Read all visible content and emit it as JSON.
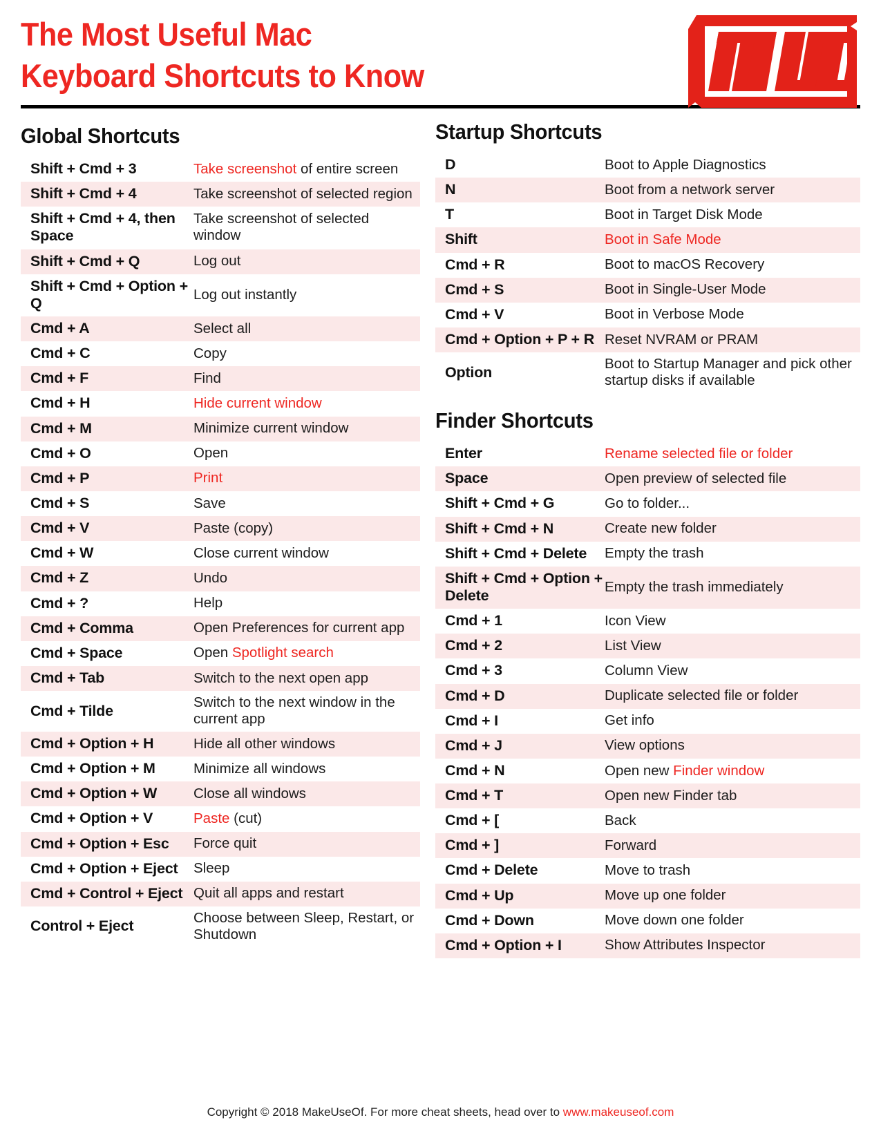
{
  "header": {
    "title": "The Most Useful Mac\nKeyboard Shortcuts to Know",
    "logo_text": "MUO",
    "accent_color": "#ee2722",
    "shade_color": "#fbe8e8"
  },
  "sections": [
    {
      "id": "global",
      "heading": "Global Shortcuts",
      "rows": [
        {
          "keys": "Shift + Cmd + 3",
          "desc_parts": [
            {
              "t": "Take screenshot",
              "hl": true
            },
            {
              "t": " of entire screen",
              "hl": false
            }
          ]
        },
        {
          "keys": "Shift + Cmd + 4",
          "desc_parts": [
            {
              "t": "Take screenshot of selected region",
              "hl": false
            }
          ]
        },
        {
          "keys": "Shift + Cmd + 4, then Space",
          "desc_parts": [
            {
              "t": "Take screenshot of selected window",
              "hl": false
            }
          ]
        },
        {
          "keys": "Shift + Cmd + Q",
          "desc_parts": [
            {
              "t": "Log out",
              "hl": false
            }
          ]
        },
        {
          "keys": "Shift + Cmd + Option + Q",
          "desc_parts": [
            {
              "t": "Log out instantly",
              "hl": false
            }
          ]
        },
        {
          "keys": "Cmd + A",
          "desc_parts": [
            {
              "t": "Select all",
              "hl": false
            }
          ]
        },
        {
          "keys": "Cmd + C",
          "desc_parts": [
            {
              "t": "Copy",
              "hl": false
            }
          ]
        },
        {
          "keys": "Cmd + F",
          "desc_parts": [
            {
              "t": "Find",
              "hl": false
            }
          ]
        },
        {
          "keys": "Cmd + H",
          "desc_parts": [
            {
              "t": "Hide current window",
              "hl": true
            }
          ]
        },
        {
          "keys": "Cmd + M",
          "desc_parts": [
            {
              "t": "Minimize current window",
              "hl": false
            }
          ]
        },
        {
          "keys": "Cmd + O",
          "desc_parts": [
            {
              "t": "Open",
              "hl": false
            }
          ]
        },
        {
          "keys": "Cmd + P",
          "desc_parts": [
            {
              "t": "Print",
              "hl": true
            }
          ]
        },
        {
          "keys": "Cmd + S",
          "desc_parts": [
            {
              "t": "Save",
              "hl": false
            }
          ]
        },
        {
          "keys": "Cmd + V",
          "desc_parts": [
            {
              "t": "Paste (copy)",
              "hl": false
            }
          ]
        },
        {
          "keys": "Cmd + W",
          "desc_parts": [
            {
              "t": "Close current window",
              "hl": false
            }
          ]
        },
        {
          "keys": "Cmd + Z",
          "desc_parts": [
            {
              "t": "Undo",
              "hl": false
            }
          ]
        },
        {
          "keys": "Cmd + ?",
          "desc_parts": [
            {
              "t": "Help",
              "hl": false
            }
          ]
        },
        {
          "keys": "Cmd + Comma",
          "desc_parts": [
            {
              "t": "Open Preferences for current app",
              "hl": false
            }
          ]
        },
        {
          "keys": "Cmd + Space",
          "desc_parts": [
            {
              "t": "Open ",
              "hl": false
            },
            {
              "t": "Spotlight search",
              "hl": true
            }
          ]
        },
        {
          "keys": "Cmd + Tab",
          "desc_parts": [
            {
              "t": "Switch to the next open app",
              "hl": false
            }
          ]
        },
        {
          "keys": "Cmd + Tilde",
          "desc_parts": [
            {
              "t": "Switch to the next window in the current app",
              "hl": false
            }
          ]
        },
        {
          "keys": "Cmd + Option + H",
          "desc_parts": [
            {
              "t": "Hide all other windows",
              "hl": false
            }
          ]
        },
        {
          "keys": "Cmd + Option + M",
          "desc_parts": [
            {
              "t": "Minimize all windows",
              "hl": false
            }
          ]
        },
        {
          "keys": "Cmd + Option + W",
          "desc_parts": [
            {
              "t": "Close all windows",
              "hl": false
            }
          ]
        },
        {
          "keys": "Cmd + Option + V",
          "desc_parts": [
            {
              "t": "Paste",
              "hl": true
            },
            {
              "t": " (cut)",
              "hl": false
            }
          ]
        },
        {
          "keys": "Cmd + Option + Esc",
          "desc_parts": [
            {
              "t": "Force quit",
              "hl": false
            }
          ]
        },
        {
          "keys": "Cmd + Option + Eject",
          "desc_parts": [
            {
              "t": "Sleep",
              "hl": false
            }
          ]
        },
        {
          "keys": "Cmd + Control + Eject",
          "desc_parts": [
            {
              "t": "Quit all apps and restart",
              "hl": false
            }
          ]
        },
        {
          "keys": "Control + Eject",
          "desc_parts": [
            {
              "t": "Choose between Sleep, Restart, or Shutdown",
              "hl": false
            }
          ]
        }
      ]
    },
    {
      "id": "startup",
      "heading": "Startup Shortcuts",
      "rows": [
        {
          "keys": "D",
          "desc_parts": [
            {
              "t": "Boot to Apple Diagnostics",
              "hl": false
            }
          ]
        },
        {
          "keys": "N",
          "desc_parts": [
            {
              "t": "Boot from a network server",
              "hl": false
            }
          ]
        },
        {
          "keys": "T",
          "desc_parts": [
            {
              "t": "Boot in Target Disk Mode",
              "hl": false
            }
          ]
        },
        {
          "keys": "Shift",
          "desc_parts": [
            {
              "t": "Boot in Safe Mode",
              "hl": true
            }
          ]
        },
        {
          "keys": "Cmd + R",
          "desc_parts": [
            {
              "t": "Boot to macOS Recovery",
              "hl": false
            }
          ]
        },
        {
          "keys": "Cmd + S",
          "desc_parts": [
            {
              "t": "Boot in Single-User Mode",
              "hl": false
            }
          ]
        },
        {
          "keys": "Cmd + V",
          "desc_parts": [
            {
              "t": "Boot in Verbose Mode",
              "hl": false
            }
          ]
        },
        {
          "keys": "Cmd + Option + P + R",
          "desc_parts": [
            {
              "t": "Reset NVRAM or PRAM",
              "hl": false
            }
          ]
        },
        {
          "keys": "Option",
          "desc_parts": [
            {
              "t": "Boot to Startup Manager and pick other startup disks if available",
              "hl": false
            }
          ]
        }
      ]
    },
    {
      "id": "finder",
      "heading": "Finder Shortcuts",
      "rows": [
        {
          "keys": "Enter",
          "desc_parts": [
            {
              "t": "Rename selected file or folder",
              "hl": true
            }
          ]
        },
        {
          "keys": "Space",
          "desc_parts": [
            {
              "t": "Open preview of selected file",
              "hl": false
            }
          ]
        },
        {
          "keys": "Shift + Cmd + G",
          "desc_parts": [
            {
              "t": "Go to folder...",
              "hl": false
            }
          ]
        },
        {
          "keys": "Shift + Cmd + N",
          "desc_parts": [
            {
              "t": "Create new folder",
              "hl": false
            }
          ]
        },
        {
          "keys": "Shift + Cmd + Delete",
          "desc_parts": [
            {
              "t": "Empty the trash",
              "hl": false
            }
          ]
        },
        {
          "keys": "Shift + Cmd + Option + Delete",
          "desc_parts": [
            {
              "t": "Empty the trash immediately",
              "hl": false
            }
          ]
        },
        {
          "keys": "Cmd + 1",
          "desc_parts": [
            {
              "t": "Icon View",
              "hl": false
            }
          ]
        },
        {
          "keys": "Cmd + 2",
          "desc_parts": [
            {
              "t": "List View",
              "hl": false
            }
          ]
        },
        {
          "keys": "Cmd + 3",
          "desc_parts": [
            {
              "t": "Column View",
              "hl": false
            }
          ]
        },
        {
          "keys": "Cmd + D",
          "desc_parts": [
            {
              "t": "Duplicate selected file or folder",
              "hl": false
            }
          ]
        },
        {
          "keys": "Cmd + I",
          "desc_parts": [
            {
              "t": "Get info",
              "hl": false
            }
          ]
        },
        {
          "keys": "Cmd + J",
          "desc_parts": [
            {
              "t": "View options",
              "hl": false
            }
          ]
        },
        {
          "keys": "Cmd + N",
          "desc_parts": [
            {
              "t": "Open new ",
              "hl": false
            },
            {
              "t": "Finder window",
              "hl": true
            }
          ]
        },
        {
          "keys": "Cmd + T",
          "desc_parts": [
            {
              "t": "Open new Finder tab",
              "hl": false
            }
          ]
        },
        {
          "keys": "Cmd + [",
          "desc_parts": [
            {
              "t": "Back",
              "hl": false
            }
          ]
        },
        {
          "keys": "Cmd + ]",
          "desc_parts": [
            {
              "t": "Forward",
              "hl": false
            }
          ]
        },
        {
          "keys": "Cmd + Delete",
          "desc_parts": [
            {
              "t": "Move to trash",
              "hl": false
            }
          ]
        },
        {
          "keys": "Cmd + Up",
          "desc_parts": [
            {
              "t": "Move up one folder",
              "hl": false
            }
          ]
        },
        {
          "keys": "Cmd + Down",
          "desc_parts": [
            {
              "t": "Move down one folder",
              "hl": false
            }
          ]
        },
        {
          "keys": "Cmd + Option + I",
          "desc_parts": [
            {
              "t": "Show Attributes Inspector",
              "hl": false
            }
          ]
        }
      ]
    }
  ],
  "footer": {
    "text": "Copyright © 2018 MakeUseOf. For more cheat sheets, head over to ",
    "url": "www.makeuseof.com"
  }
}
